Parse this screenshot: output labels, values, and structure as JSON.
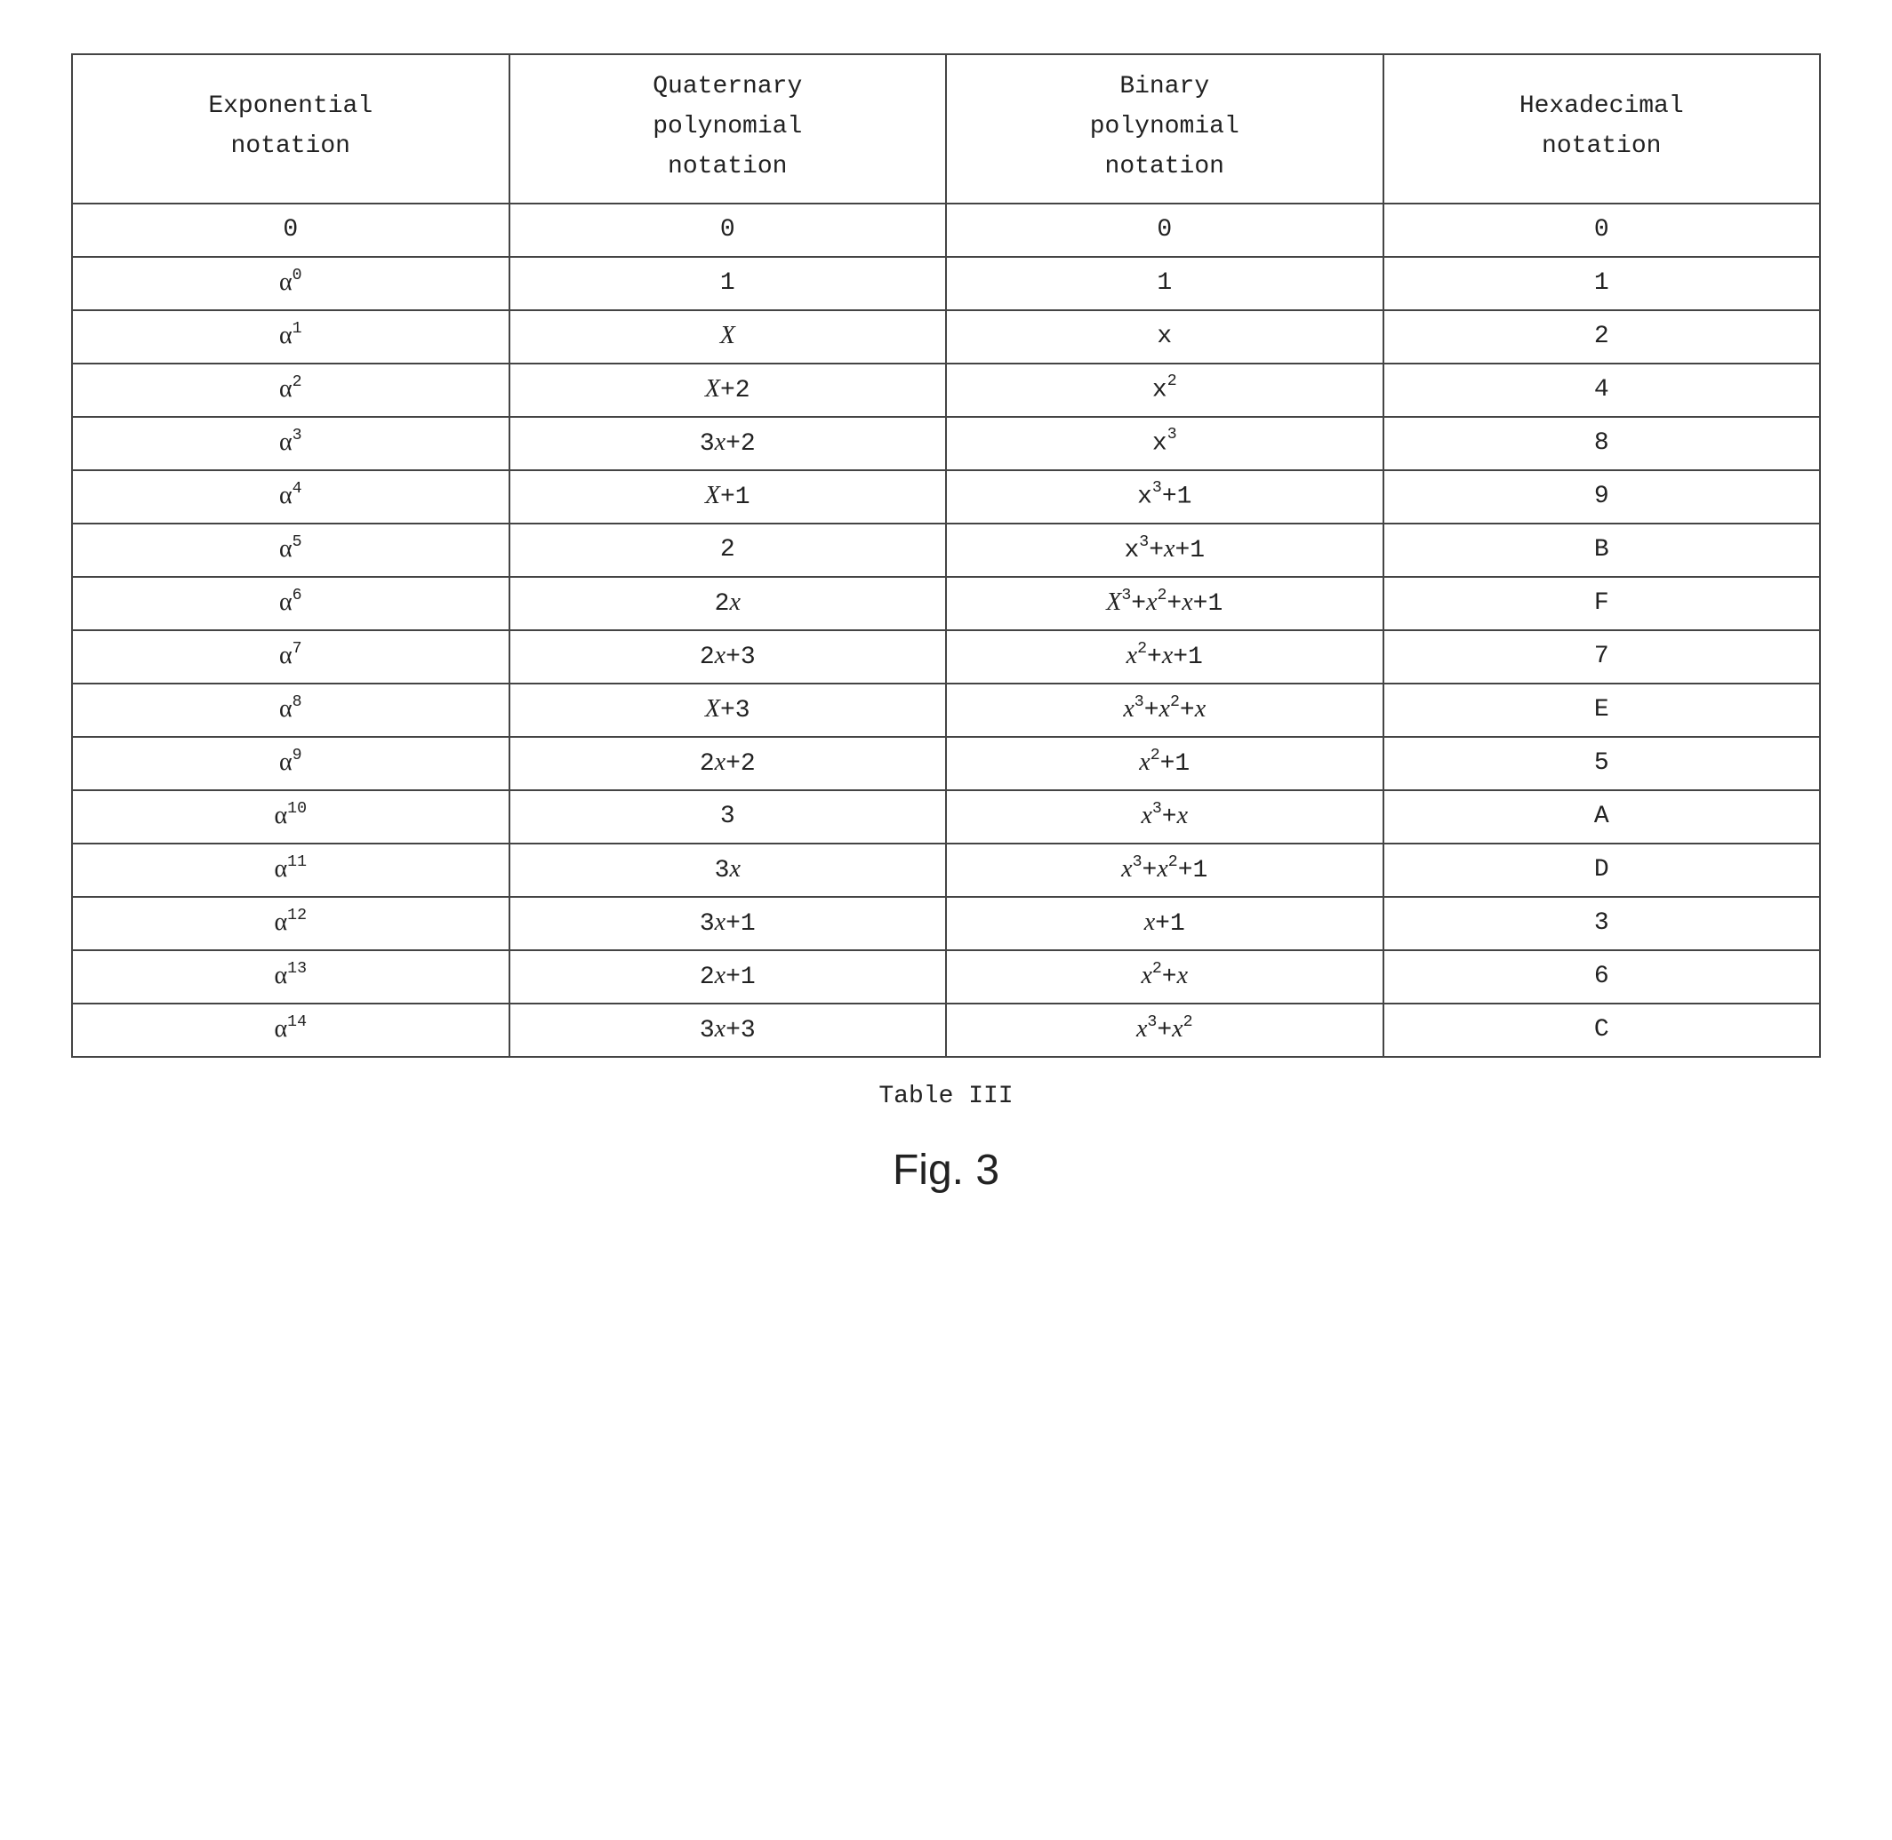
{
  "headers": {
    "c1": "Exponential\nnotation",
    "c2": "Quaternary\npolynomial\nnotation",
    "c3": "Binary\npolynomial\nnotation",
    "c4": "Hexadecimal\nnotation"
  },
  "rows": [
    {
      "exp_html": "0",
      "quat_html": "0",
      "bin_html": "0",
      "hex": "0"
    },
    {
      "exp_html": "<span class='alpha'>α</span><sup>0</sup>",
      "quat_html": "1",
      "bin_html": "1",
      "hex": "1"
    },
    {
      "exp_html": "<span class='alpha'>α</span><sup>1</sup>",
      "quat_html": "<span class='ital'>X</span>",
      "bin_html": "x",
      "hex": "2"
    },
    {
      "exp_html": "<span class='alpha'>α</span><sup>2</sup>",
      "quat_html": "<span class='ital'>X</span>+2",
      "bin_html": "x<sup>2</sup>",
      "hex": "4"
    },
    {
      "exp_html": "<span class='alpha'>α</span><sup>3</sup>",
      "quat_html": "3<span class='ital'>x</span>+2",
      "bin_html": "x<sup>3</sup>",
      "hex": "8"
    },
    {
      "exp_html": "<span class='alpha'>α</span><sup>4</sup>",
      "quat_html": "<span class='ital'>X</span>+1",
      "bin_html": "x<sup>3</sup>+1",
      "hex": "9"
    },
    {
      "exp_html": "<span class='alpha'>α</span><sup>5</sup>",
      "quat_html": "2",
      "bin_html": "x<sup>3</sup>+<span class='ital'>x</span>+1",
      "hex": "B"
    },
    {
      "exp_html": "<span class='alpha'>α</span><sup>6</sup>",
      "quat_html": "2<span class='ital'>x</span>",
      "bin_html": "<span class='ital'>X</span><sup>3</sup>+<span class='ital'>x</span><sup>2</sup>+<span class='ital'>x</span>+1",
      "hex": "F"
    },
    {
      "exp_html": "<span class='alpha'>α</span><sup>7</sup>",
      "quat_html": "2<span class='ital'>x</span>+3",
      "bin_html": "<span class='ital'>x</span><sup>2</sup>+<span class='ital'>x</span>+1",
      "hex": "7"
    },
    {
      "exp_html": "<span class='alpha'>α</span><sup>8</sup>",
      "quat_html": "<span class='ital'>X</span>+3",
      "bin_html": "<span class='ital'>x</span><sup>3</sup>+<span class='ital'>x</span><sup>2</sup>+<span class='ital'>x</span>",
      "hex": "E"
    },
    {
      "exp_html": "<span class='alpha'>α</span><sup>9</sup>",
      "quat_html": "2<span class='ital'>x</span>+2",
      "bin_html": "<span class='ital'>x</span><sup>2</sup>+1",
      "hex": "5"
    },
    {
      "exp_html": "<span class='alpha'>α</span><sup>10</sup>",
      "quat_html": "3",
      "bin_html": "<span class='ital'>x</span><sup>3</sup>+<span class='ital'>x</span>",
      "hex": "A"
    },
    {
      "exp_html": "<span class='alpha'>α</span><sup>11</sup>",
      "quat_html": "3<span class='ital'>x</span>",
      "bin_html": "<span class='ital'>x</span><sup>3</sup>+<span class='ital'>x</span><sup>2</sup>+1",
      "hex": "D"
    },
    {
      "exp_html": "<span class='alpha'>α</span><sup>12</sup>",
      "quat_html": "3<span class='ital'>x</span>+1",
      "bin_html": "<span class='ital'>x</span>+1",
      "hex": "3"
    },
    {
      "exp_html": "<span class='alpha'>α</span><sup>13</sup>",
      "quat_html": "2<span class='ital'>x</span>+1",
      "bin_html": "<span class='ital'>x</span><sup>2</sup>+<span class='ital'>x</span>",
      "hex": "6"
    },
    {
      "exp_html": "<span class='alpha'>α</span><sup>14</sup>",
      "quat_html": "3<span class='ital'>x</span>+3",
      "bin_html": "<span class='ital'>x</span><sup>3</sup>+<span class='ital'>x</span><sup>2</sup>",
      "hex": "C"
    }
  ],
  "caption": "Table III",
  "figure_label": "Fig. 3",
  "chart_data": {
    "type": "table",
    "title": "Table III",
    "columns": [
      "Exponential notation",
      "Quaternary polynomial notation",
      "Binary polynomial notation",
      "Hexadecimal notation"
    ],
    "rows": [
      [
        "0",
        "0",
        "0",
        "0"
      ],
      [
        "α^0",
        "1",
        "1",
        "1"
      ],
      [
        "α^1",
        "X",
        "x",
        "2"
      ],
      [
        "α^2",
        "X+2",
        "x^2",
        "4"
      ],
      [
        "α^3",
        "3x+2",
        "x^3",
        "8"
      ],
      [
        "α^4",
        "X+1",
        "x^3+1",
        "9"
      ],
      [
        "α^5",
        "2",
        "x^3+x+1",
        "B"
      ],
      [
        "α^6",
        "2x",
        "X^3+x^2+x+1",
        "F"
      ],
      [
        "α^7",
        "2x+3",
        "x^2+x+1",
        "7"
      ],
      [
        "α^8",
        "X+3",
        "x^3+x^2+x",
        "E"
      ],
      [
        "α^9",
        "2x+2",
        "x^2+1",
        "5"
      ],
      [
        "α^10",
        "3",
        "x^3+x",
        "A"
      ],
      [
        "α^11",
        "3x",
        "x^3+x^2+1",
        "D"
      ],
      [
        "α^12",
        "3x+1",
        "x+1",
        "3"
      ],
      [
        "α^13",
        "2x+1",
        "x^2+x",
        "6"
      ],
      [
        "α^14",
        "3x+3",
        "x^3+x^2",
        "C"
      ]
    ]
  }
}
